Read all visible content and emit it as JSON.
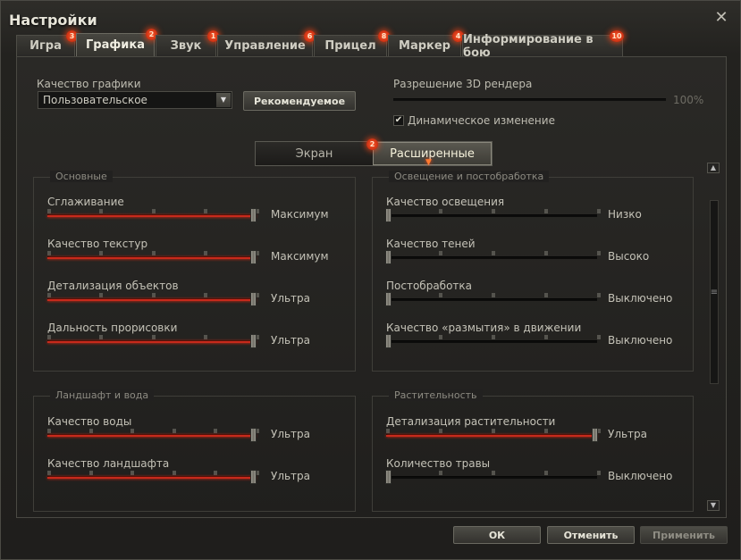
{
  "window": {
    "title": "Настройки"
  },
  "tabs": [
    {
      "label": "Игра",
      "badge": "3"
    },
    {
      "label": "Графика",
      "badge": "2"
    },
    {
      "label": "Звук",
      "badge": "1"
    },
    {
      "label": "Управление",
      "badge": "6"
    },
    {
      "label": "Прицел",
      "badge": "8"
    },
    {
      "label": "Маркер",
      "badge": "4"
    },
    {
      "label": "Информирование в бою",
      "badge": "10"
    }
  ],
  "graphics": {
    "quality_label": "Качество графики",
    "quality_value": "Пользовательское",
    "recommended_button": "Рекомендуемое",
    "render_label": "Разрешение 3D рендера",
    "render_value": "100%",
    "dynamic_label": "Динамическое изменение",
    "dynamic_checked": true
  },
  "subtabs": {
    "screen": "Экран",
    "advanced": "Расширенные",
    "advanced_badge": "2"
  },
  "groups": {
    "basic": {
      "title": "Основные",
      "rows": [
        {
          "label": "Сглаживание",
          "value": "Максимум",
          "level": 1.0
        },
        {
          "label": "Качество текстур",
          "value": "Максимум",
          "level": 1.0
        },
        {
          "label": "Детализация объектов",
          "value": "Ультра",
          "level": 1.0
        },
        {
          "label": "Дальность прорисовки",
          "value": "Ультра",
          "level": 1.0
        }
      ]
    },
    "lighting": {
      "title": "Освещение и постобработка",
      "rows": [
        {
          "label": "Качество освещения",
          "value": "Низко",
          "level": 0.0
        },
        {
          "label": "Качество теней",
          "value": "Высоко",
          "level": 0.0
        },
        {
          "label": "Постобработка",
          "value": "Выключено",
          "level": 0.0
        },
        {
          "label": "Качество «размытия» в движении",
          "value": "Выключено",
          "level": 0.0
        }
      ]
    },
    "landscape": {
      "title": "Ландшафт и вода",
      "rows": [
        {
          "label": "Качество воды",
          "value": "Ультра",
          "level": 1.0
        },
        {
          "label": "Качество ландшафта",
          "value": "Ультра",
          "level": 1.0
        }
      ]
    },
    "vegetation": {
      "title": "Растительность",
      "rows": [
        {
          "label": "Детализация растительности",
          "value": "Ультра",
          "level": 1.0
        },
        {
          "label": "Количество травы",
          "value": "Выключено",
          "level": 0.0
        }
      ]
    }
  },
  "buttons": {
    "ok": "ОК",
    "cancel": "Отменить",
    "apply": "Применить"
  },
  "colors": {
    "accent_red": "#c72a1c",
    "badge": "#e0381a",
    "active_text": "#f6f2dc"
  }
}
